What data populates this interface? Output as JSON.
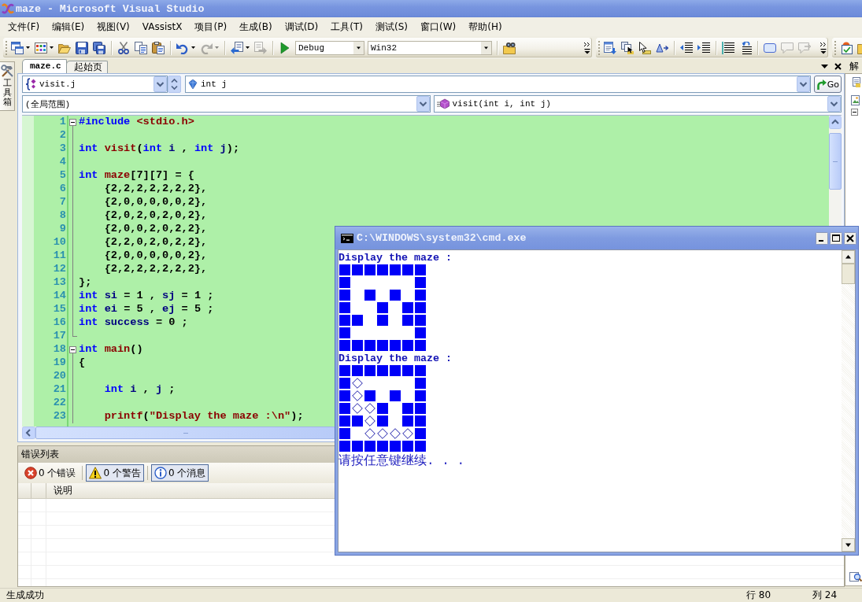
{
  "window": {
    "title": "maze - Microsoft Visual Studio"
  },
  "menu": [
    "文件(F)",
    "编辑(E)",
    "视图(V)",
    "VAssistX",
    "项目(P)",
    "生成(B)",
    "调试(D)",
    "工具(T)",
    "测试(S)",
    "窗口(W)",
    "帮助(H)"
  ],
  "toolbar": {
    "standard": [
      {
        "disabled": false
      },
      {
        "disabled": false
      },
      {
        "disabled": false
      },
      {
        "disabled": false
      },
      {
        "disabled": false
      },
      {
        "disabled": false
      },
      {
        "disabled": false
      },
      {
        "disabled": false
      },
      {
        "disabled": false
      },
      {
        "disabled": true
      },
      {
        "disabled": false
      },
      {
        "disabled": true
      },
      {
        "disabled": false
      },
      {
        "disabled": false
      }
    ],
    "configuration": "Debug",
    "platform": "Win32",
    "text_editor": [
      {
        "disabled": false
      },
      {
        "disabled": false
      },
      {
        "disabled": false
      },
      {
        "disabled": false
      },
      {
        "disabled": false
      },
      {
        "disabled": false
      },
      {
        "disabled": false
      },
      {
        "disabled": false
      },
      {
        "disabled": false
      },
      {
        "disabled": true
      },
      {
        "disabled": true
      }
    ],
    "extra": [
      {
        "disabled": false
      },
      {
        "disabled": false
      }
    ]
  },
  "toolbox": {
    "label": "工具箱"
  },
  "tabs": [
    {
      "label": "maze.c",
      "selected": true
    },
    {
      "label": "起始页",
      "selected": false
    }
  ],
  "editor": {
    "navigation": {
      "class_scope": "visit.j",
      "member": "int j",
      "scope": "(全局范围)",
      "function": "visit(int i, int j)",
      "go": "Go"
    },
    "lines": [
      {
        "number": "1",
        "kind": "start",
        "tokens": [
          {
            "kind": "preprocessor",
            "text": "#include"
          },
          {
            "kind": "string",
            "text": " <stdio.h>"
          }
        ]
      },
      {
        "number": "2",
        "kind": "body"
      },
      {
        "number": "3",
        "kind": "body",
        "tokens": [
          {
            "kind": "keyword",
            "text": "int"
          },
          {
            "kind": "function",
            "text": " visit"
          },
          {
            "kind": "plain",
            "text": "("
          },
          {
            "kind": "keyword",
            "text": "int"
          },
          {
            "kind": "variable",
            "text": " i"
          },
          {
            "kind": "plain",
            "text": " , "
          },
          {
            "kind": "keyword",
            "text": "int"
          },
          {
            "kind": "variable",
            "text": " j"
          },
          {
            "kind": "plain",
            "text": ");"
          }
        ]
      },
      {
        "number": "4",
        "kind": "body"
      },
      {
        "number": "5",
        "kind": "body",
        "tokens": [
          {
            "kind": "keyword",
            "text": "int"
          },
          {
            "kind": "function",
            "text": " maze"
          },
          {
            "kind": "plain",
            "text": "[7][7] = {"
          }
        ]
      },
      {
        "number": "6",
        "kind": "body",
        "tokens": [
          {
            "kind": "plain",
            "text": "    {2,2,2,2,2,2,2},"
          }
        ]
      },
      {
        "number": "7",
        "kind": "body",
        "tokens": [
          {
            "kind": "plain",
            "text": "    {2,0,0,0,0,0,2},"
          }
        ]
      },
      {
        "number": "8",
        "kind": "body",
        "tokens": [
          {
            "kind": "plain",
            "text": "    {2,0,2,0,2,0,2},"
          }
        ]
      },
      {
        "number": "9",
        "kind": "body",
        "tokens": [
          {
            "kind": "plain",
            "text": "    {2,0,0,2,0,2,2},"
          }
        ]
      },
      {
        "number": "10",
        "kind": "body",
        "tokens": [
          {
            "kind": "plain",
            "text": "    {2,2,0,2,0,2,2},"
          }
        ]
      },
      {
        "number": "11",
        "kind": "body",
        "tokens": [
          {
            "kind": "plain",
            "text": "    {2,0,0,0,0,0,2},"
          }
        ]
      },
      {
        "number": "12",
        "kind": "body",
        "tokens": [
          {
            "kind": "plain",
            "text": "    {2,2,2,2,2,2,2},"
          }
        ]
      },
      {
        "number": "13",
        "kind": "body",
        "tokens": [
          {
            "kind": "plain",
            "text": "};"
          }
        ]
      },
      {
        "number": "14",
        "kind": "body",
        "tokens": [
          {
            "kind": "keyword",
            "text": "int"
          },
          {
            "kind": "variable",
            "text": " si"
          },
          {
            "kind": "plain",
            "text": " = 1 , "
          },
          {
            "kind": "variable",
            "text": "sj"
          },
          {
            "kind": "plain",
            "text": " = 1 ;"
          }
        ]
      },
      {
        "number": "15",
        "kind": "body",
        "tokens": [
          {
            "kind": "keyword",
            "text": "int"
          },
          {
            "kind": "variable",
            "text": " ei"
          },
          {
            "kind": "plain",
            "text": " = 5 , "
          },
          {
            "kind": "variable",
            "text": "ej"
          },
          {
            "kind": "plain",
            "text": " = 5 ;"
          }
        ]
      },
      {
        "number": "16",
        "kind": "body",
        "tokens": [
          {
            "kind": "keyword",
            "text": "int"
          },
          {
            "kind": "variable",
            "text": " success"
          },
          {
            "kind": "plain",
            "text": " = 0 ;"
          }
        ]
      },
      {
        "number": "17",
        "kind": "end"
      },
      {
        "number": "18",
        "kind": "start",
        "tokens": [
          {
            "kind": "keyword",
            "text": "int"
          },
          {
            "kind": "function",
            "text": " main"
          },
          {
            "kind": "plain",
            "text": "()"
          }
        ]
      },
      {
        "number": "19",
        "kind": "body",
        "tokens": [
          {
            "kind": "plain",
            "text": "{"
          }
        ]
      },
      {
        "number": "20",
        "kind": "body"
      },
      {
        "number": "21",
        "kind": "body",
        "tokens": [
          {
            "kind": "keyword",
            "text": "    int"
          },
          {
            "kind": "variable",
            "text": " i"
          },
          {
            "kind": "plain",
            "text": " , "
          },
          {
            "kind": "variable",
            "text": "j"
          },
          {
            "kind": "plain",
            "text": " ;"
          }
        ]
      },
      {
        "number": "22",
        "kind": "body"
      },
      {
        "number": "23",
        "kind": "body",
        "tokens": [
          {
            "kind": "function",
            "text": "    printf"
          },
          {
            "kind": "plain",
            "text": "("
          },
          {
            "kind": "string",
            "text": "\"Display the maze :\\n\""
          },
          {
            "kind": "plain",
            "text": ");"
          }
        ]
      }
    ]
  },
  "error_list": {
    "title": "错误列表",
    "filters": [
      {
        "kind": "error",
        "label": "0 个错误",
        "checked": false
      },
      {
        "kind": "warning",
        "label": "0 个警告",
        "checked": true
      },
      {
        "kind": "info",
        "label": "0 个消息",
        "checked": true
      }
    ],
    "columns": [
      "说明"
    ]
  },
  "solution_explorer": {
    "title": "解"
  },
  "status_bar": {
    "message": "生成成功",
    "line": "行 80",
    "column": "列 24"
  },
  "console": {
    "title": "C:\\WINDOWS\\system32\\cmd.exe",
    "lines": [
      {
        "kind": "text",
        "text": "Display the maze :"
      },
      {
        "kind": "maze",
        "cells": [
          {
            "kind": "wall"
          },
          {
            "kind": "wall"
          },
          {
            "kind": "wall"
          },
          {
            "kind": "wall"
          },
          {
            "kind": "wall"
          },
          {
            "kind": "wall"
          },
          {
            "kind": "wall"
          }
        ]
      },
      {
        "kind": "maze",
        "cells": [
          {
            "kind": "wall"
          },
          {
            "kind": "empty"
          },
          {
            "kind": "empty"
          },
          {
            "kind": "empty"
          },
          {
            "kind": "empty"
          },
          {
            "kind": "empty"
          },
          {
            "kind": "wall"
          }
        ]
      },
      {
        "kind": "maze",
        "cells": [
          {
            "kind": "wall"
          },
          {
            "kind": "empty"
          },
          {
            "kind": "wall"
          },
          {
            "kind": "empty"
          },
          {
            "kind": "wall"
          },
          {
            "kind": "empty"
          },
          {
            "kind": "wall"
          }
        ]
      },
      {
        "kind": "maze",
        "cells": [
          {
            "kind": "wall"
          },
          {
            "kind": "empty"
          },
          {
            "kind": "empty"
          },
          {
            "kind": "wall"
          },
          {
            "kind": "empty"
          },
          {
            "kind": "wall"
          },
          {
            "kind": "wall"
          }
        ]
      },
      {
        "kind": "maze",
        "cells": [
          {
            "kind": "wall"
          },
          {
            "kind": "wall"
          },
          {
            "kind": "empty"
          },
          {
            "kind": "wall"
          },
          {
            "kind": "empty"
          },
          {
            "kind": "wall"
          },
          {
            "kind": "wall"
          }
        ]
      },
      {
        "kind": "maze",
        "cells": [
          {
            "kind": "wall"
          },
          {
            "kind": "empty"
          },
          {
            "kind": "empty"
          },
          {
            "kind": "empty"
          },
          {
            "kind": "empty"
          },
          {
            "kind": "empty"
          },
          {
            "kind": "wall"
          }
        ]
      },
      {
        "kind": "maze",
        "cells": [
          {
            "kind": "wall"
          },
          {
            "kind": "wall"
          },
          {
            "kind": "wall"
          },
          {
            "kind": "wall"
          },
          {
            "kind": "wall"
          },
          {
            "kind": "wall"
          },
          {
            "kind": "wall"
          }
        ]
      },
      {
        "kind": "text",
        "text": "Display the maze :"
      },
      {
        "kind": "maze",
        "cells": [
          {
            "kind": "wall"
          },
          {
            "kind": "wall"
          },
          {
            "kind": "wall"
          },
          {
            "kind": "wall"
          },
          {
            "kind": "wall"
          },
          {
            "kind": "wall"
          },
          {
            "kind": "wall"
          }
        ]
      },
      {
        "kind": "maze",
        "cells": [
          {
            "kind": "wall"
          },
          {
            "kind": "path"
          },
          {
            "kind": "empty"
          },
          {
            "kind": "empty"
          },
          {
            "kind": "empty"
          },
          {
            "kind": "empty"
          },
          {
            "kind": "wall"
          }
        ]
      },
      {
        "kind": "maze",
        "cells": [
          {
            "kind": "wall"
          },
          {
            "kind": "path"
          },
          {
            "kind": "wall"
          },
          {
            "kind": "empty"
          },
          {
            "kind": "wall"
          },
          {
            "kind": "empty"
          },
          {
            "kind": "wall"
          }
        ]
      },
      {
        "kind": "maze",
        "cells": [
          {
            "kind": "wall"
          },
          {
            "kind": "path"
          },
          {
            "kind": "path"
          },
          {
            "kind": "wall"
          },
          {
            "kind": "empty"
          },
          {
            "kind": "wall"
          },
          {
            "kind": "wall"
          }
        ]
      },
      {
        "kind": "maze",
        "cells": [
          {
            "kind": "wall"
          },
          {
            "kind": "wall"
          },
          {
            "kind": "path"
          },
          {
            "kind": "wall"
          },
          {
            "kind": "empty"
          },
          {
            "kind": "wall"
          },
          {
            "kind": "wall"
          }
        ]
      },
      {
        "kind": "maze",
        "cells": [
          {
            "kind": "wall"
          },
          {
            "kind": "empty"
          },
          {
            "kind": "path"
          },
          {
            "kind": "path"
          },
          {
            "kind": "path"
          },
          {
            "kind": "path"
          },
          {
            "kind": "wall"
          }
        ]
      },
      {
        "kind": "maze",
        "cells": [
          {
            "kind": "wall"
          },
          {
            "kind": "wall"
          },
          {
            "kind": "wall"
          },
          {
            "kind": "wall"
          },
          {
            "kind": "wall"
          },
          {
            "kind": "wall"
          },
          {
            "kind": "wall"
          }
        ]
      },
      {
        "kind": "prompt",
        "text": "请按任意键继续. . ."
      }
    ]
  }
}
